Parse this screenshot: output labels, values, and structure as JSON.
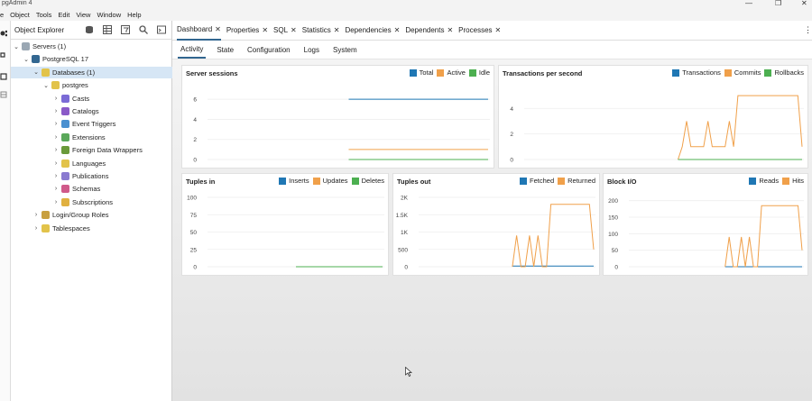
{
  "window": {
    "title": "pgAdmin 4"
  },
  "menu": [
    "e",
    "Object",
    "Tools",
    "Edit",
    "View",
    "Window",
    "Help"
  ],
  "explorer": {
    "title": "Object Explorer",
    "tree": [
      {
        "label": "Servers (1)",
        "arrow": "⌄",
        "icon": "servers-icon",
        "color": "#9aa7b3",
        "level": 0
      },
      {
        "label": "PostgreSQL 17",
        "arrow": "⌄",
        "icon": "postgresql-server-icon",
        "color": "#336791",
        "level": 1
      },
      {
        "label": "Databases (1)",
        "arrow": "⌄",
        "icon": "databases-icon",
        "color": "#e2c34a",
        "level": 2,
        "selected": true
      },
      {
        "label": "postgres",
        "arrow": "⌄",
        "icon": "database-icon",
        "color": "#e2c34a",
        "level": 3
      },
      {
        "label": "Casts",
        "arrow": "›",
        "icon": "casts-icon",
        "color": "#7b6bd6",
        "level": 4
      },
      {
        "label": "Catalogs",
        "arrow": "›",
        "icon": "catalogs-icon",
        "color": "#8a5ac8",
        "level": 4
      },
      {
        "label": "Event Triggers",
        "arrow": "›",
        "icon": "event-triggers-icon",
        "color": "#4a90d0",
        "level": 4
      },
      {
        "label": "Extensions",
        "arrow": "›",
        "icon": "extensions-icon",
        "color": "#5aa85a",
        "level": 4
      },
      {
        "label": "Foreign Data Wrappers",
        "arrow": "›",
        "icon": "foreign-data-wrappers-icon",
        "color": "#6a9a3a",
        "level": 4
      },
      {
        "label": "Languages",
        "arrow": "›",
        "icon": "languages-icon",
        "color": "#e2c34a",
        "level": 4
      },
      {
        "label": "Publications",
        "arrow": "›",
        "icon": "publications-icon",
        "color": "#8a7ad0",
        "level": 4
      },
      {
        "label": "Schemas",
        "arrow": "›",
        "icon": "schemas-icon",
        "color": "#d05a8a",
        "level": 4
      },
      {
        "label": "Subscriptions",
        "arrow": "›",
        "icon": "subscriptions-icon",
        "color": "#e0b040",
        "level": 4
      },
      {
        "label": "Login/Group Roles",
        "arrow": "›",
        "icon": "login-roles-icon",
        "color": "#c8a040",
        "level": 2
      },
      {
        "label": "Tablespaces",
        "arrow": "›",
        "icon": "tablespaces-icon",
        "color": "#e2c34a",
        "level": 2
      }
    ]
  },
  "tabs": [
    {
      "label": "Dashboard",
      "active": true
    },
    {
      "label": "Properties"
    },
    {
      "label": "SQL"
    },
    {
      "label": "Statistics"
    },
    {
      "label": "Dependencies"
    },
    {
      "label": "Dependents"
    },
    {
      "label": "Processes"
    }
  ],
  "subtabs": [
    {
      "label": "Activity",
      "active": true
    },
    {
      "label": "State"
    },
    {
      "label": "Configuration"
    },
    {
      "label": "Logs"
    },
    {
      "label": "System"
    }
  ],
  "colors": {
    "blue": "#1f77b4",
    "orange": "#f0a04a",
    "green": "#4caf50",
    "accent": "#326690"
  },
  "chart_data": [
    {
      "type": "line",
      "title": "Server sessions",
      "series": [
        {
          "name": "Total",
          "color": "#1f77b4",
          "values": [
            6,
            6,
            6,
            6,
            6,
            6,
            6,
            6,
            6,
            6,
            6,
            6,
            6,
            6,
            6,
            6,
            6,
            6,
            6,
            6,
            6,
            6,
            6,
            6,
            6,
            6,
            6,
            6,
            6,
            6
          ]
        },
        {
          "name": "Active",
          "color": "#f0a04a",
          "values": [
            1,
            1,
            1,
            1,
            1,
            1,
            1,
            1,
            1,
            1,
            1,
            1,
            1,
            1,
            1,
            1,
            1,
            1,
            1,
            1,
            1,
            1,
            1,
            1,
            1,
            1,
            1,
            1,
            1,
            1
          ]
        },
        {
          "name": "Idle",
          "color": "#4caf50",
          "values": [
            0,
            0,
            0,
            0,
            0,
            0,
            0,
            0,
            0,
            0,
            0,
            0,
            0,
            0,
            0,
            0,
            0,
            0,
            0,
            0,
            0,
            0,
            0,
            0,
            0,
            0,
            0,
            0,
            0,
            0
          ]
        }
      ],
      "yticks": [
        0,
        2,
        4,
        6
      ],
      "ylim": [
        0,
        7
      ],
      "start_fraction": 0.5
    },
    {
      "type": "line",
      "title": "Transactions per second",
      "series": [
        {
          "name": "Transactions",
          "color": "#1f77b4",
          "values": [
            0,
            0,
            0,
            0,
            0,
            0,
            0,
            0,
            0,
            0,
            0,
            0,
            0,
            0,
            0,
            0,
            0,
            0,
            0,
            0,
            0,
            0,
            0,
            0,
            0,
            0,
            0,
            0,
            0,
            0
          ]
        },
        {
          "name": "Commits",
          "color": "#f0a04a",
          "values": [
            0,
            1,
            3,
            1,
            1,
            1,
            1,
            3,
            1,
            1,
            1,
            1,
            3,
            1,
            5,
            5,
            5,
            5,
            5,
            5,
            5,
            5,
            5,
            5,
            5,
            5,
            5,
            5,
            5,
            1
          ]
        },
        {
          "name": "Rollbacks",
          "color": "#4caf50",
          "values": [
            0,
            0,
            0,
            0,
            0,
            0,
            0,
            0,
            0,
            0,
            0,
            0,
            0,
            0,
            0,
            0,
            0,
            0,
            0,
            0,
            0,
            0,
            0,
            0,
            0,
            0,
            0,
            0,
            0,
            0
          ]
        }
      ],
      "yticks": [
        0,
        2,
        4
      ],
      "ylim": [
        0,
        5.5
      ],
      "start_fraction": 0.55
    },
    {
      "type": "line",
      "title": "Tuples in",
      "series": [
        {
          "name": "Inserts",
          "color": "#1f77b4",
          "values": [
            0,
            0,
            0,
            0,
            0,
            0,
            0,
            0,
            0,
            0,
            0,
            0,
            0,
            0,
            0,
            0,
            0,
            0,
            0,
            0
          ]
        },
        {
          "name": "Updates",
          "color": "#f0a04a",
          "values": [
            0,
            0,
            0,
            0,
            0,
            0,
            0,
            0,
            0,
            0,
            0,
            0,
            0,
            0,
            0,
            0,
            0,
            0,
            0,
            0
          ]
        },
        {
          "name": "Deletes",
          "color": "#4caf50",
          "values": [
            0,
            0,
            0,
            0,
            0,
            0,
            0,
            0,
            0,
            0,
            0,
            0,
            0,
            0,
            0,
            0,
            0,
            0,
            0,
            0
          ]
        }
      ],
      "yticks": [
        0,
        25,
        50,
        75,
        100
      ],
      "ylim": [
        0,
        100
      ],
      "start_fraction": 0.5
    },
    {
      "type": "line",
      "title": "Tuples out",
      "series": [
        {
          "name": "Fetched",
          "color": "#1f77b4",
          "values": [
            20,
            20,
            20,
            20,
            20,
            20,
            20,
            20,
            20,
            20,
            20,
            20,
            20,
            20,
            20,
            20,
            20,
            20,
            20,
            20
          ]
        },
        {
          "name": "Returned",
          "color": "#f0a04a",
          "values": [
            0,
            900,
            0,
            0,
            900,
            0,
            900,
            0,
            0,
            1800,
            1800,
            1800,
            1800,
            1800,
            1800,
            1800,
            1800,
            1800,
            1800,
            500
          ]
        }
      ],
      "yticks": [
        0,
        500,
        1000,
        1500,
        2000
      ],
      "ytick_labels": [
        "0",
        "500",
        "1K",
        "1.5K",
        "2K"
      ],
      "ylim": [
        0,
        2000
      ],
      "start_fraction": 0.53
    },
    {
      "type": "line",
      "title": "Block I/O",
      "series": [
        {
          "name": "Reads",
          "color": "#1f77b4",
          "values": [
            0,
            0,
            0,
            0,
            0,
            0,
            0,
            0,
            0,
            0,
            0,
            0,
            0,
            0,
            0,
            0,
            0,
            0,
            0,
            0
          ]
        },
        {
          "name": "Hits",
          "color": "#f0a04a",
          "values": [
            0,
            90,
            0,
            0,
            90,
            0,
            90,
            0,
            0,
            185,
            185,
            185,
            185,
            185,
            185,
            185,
            185,
            185,
            185,
            50
          ]
        }
      ],
      "yticks": [
        0,
        50,
        100,
        150,
        200
      ],
      "ylim": [
        0,
        210
      ],
      "start_fraction": 0.55
    }
  ]
}
